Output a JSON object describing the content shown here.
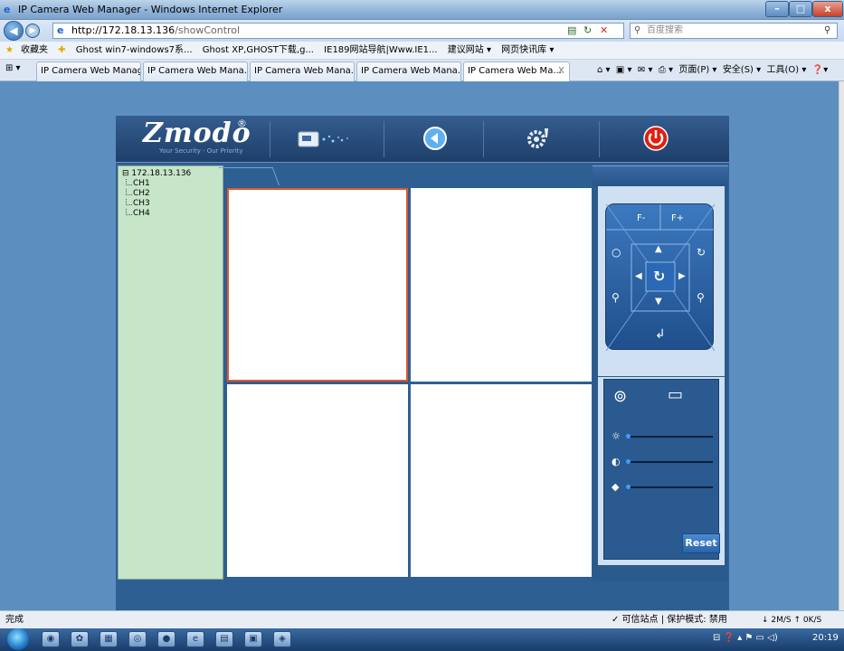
{
  "window": {
    "title": "IP Camera Web Manager - Windows Internet Explorer",
    "min_label": "–",
    "max_label": "□",
    "close_label": "x"
  },
  "addressbar": {
    "url_host": "http://172.18.13.136",
    "url_path": "/showControl",
    "search_placeholder": "百度搜索"
  },
  "favorites": {
    "label": "收藏夹",
    "items": [
      "Ghost win7-windows7系...",
      "Ghost XP,GHOST下载,g...",
      "IE189网站导航|Www.IE1...",
      "建议网站 ▾",
      "网页快讯库 ▾"
    ]
  },
  "tabs": [
    "IP Camera Web Manag...",
    "IP Camera Web Mana...",
    "IP Camera Web Mana...",
    "IP Camera Web Mana...",
    "IP Camera Web Ma..."
  ],
  "tab_close": "X",
  "commandbar": {
    "page": "页面(P) ▾",
    "safety": "安全(S) ▾",
    "tools": "工具(O) ▾"
  },
  "app": {
    "brand": "Zmodo",
    "reg": "®",
    "tagline": "Your Security · Our Priority"
  },
  "tree": {
    "root": "172.18.13.136",
    "channels": [
      "CH1",
      "CH2",
      "CH3",
      "CH4"
    ]
  },
  "ptz": {
    "focus_minus": "F-",
    "focus_plus": "F+"
  },
  "image_panel": {
    "reset_label": "Reset"
  },
  "status": {
    "text": "完成",
    "security": "✓ 可信站点 | 保护模式: 禁用",
    "speed": "↓ 2M/S ↑ 0K/S"
  },
  "taskbar": {
    "clock": "20:19"
  },
  "colors": {
    "page_bg": "#5c8fc0",
    "selected_cell_border": "#e2572a",
    "tree_bg": "#c6e5c9"
  }
}
